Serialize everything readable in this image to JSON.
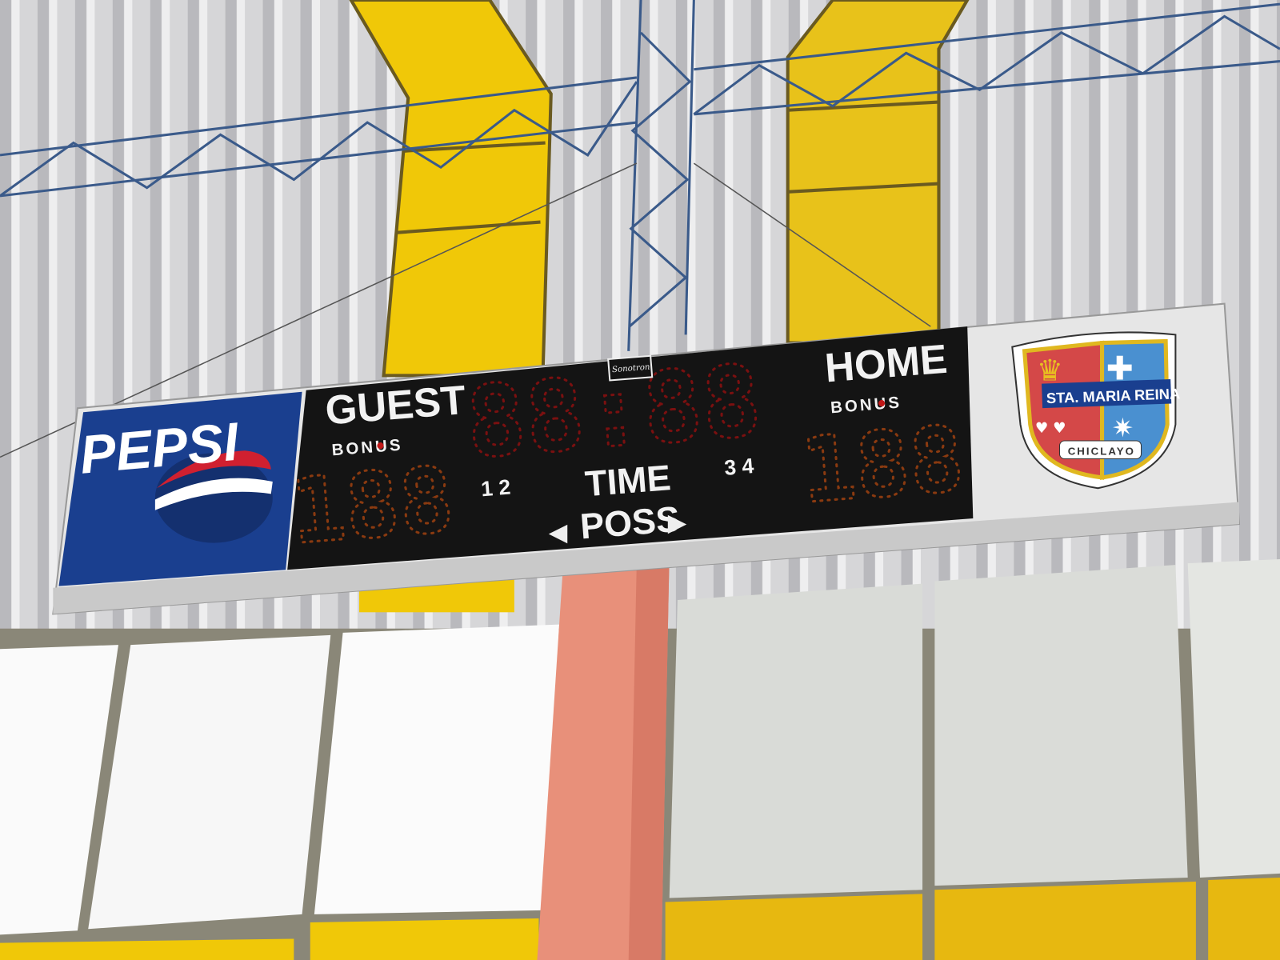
{
  "scoreboard": {
    "guest_label": "GUEST",
    "home_label": "HOME",
    "guest_bonus": "BONUS",
    "home_bonus": "BONUS",
    "time_label": "TIME",
    "poss_label": "POSS",
    "periods_left": "1 2",
    "periods_right": "3 4",
    "guest_digits": "188",
    "home_digits": "188",
    "clock_digits": "88:88",
    "maker_logo": "Sonotron"
  },
  "sponsor": {
    "brand": "PEPSI"
  },
  "crest": {
    "name": "STA. MARIA REINA",
    "city": "CHICLAYO"
  },
  "colors": {
    "pepsi_blue": "#1a3f8f",
    "beam_yellow": "#f2cc10",
    "board_black": "#141414",
    "pillar": "#e8907a"
  }
}
